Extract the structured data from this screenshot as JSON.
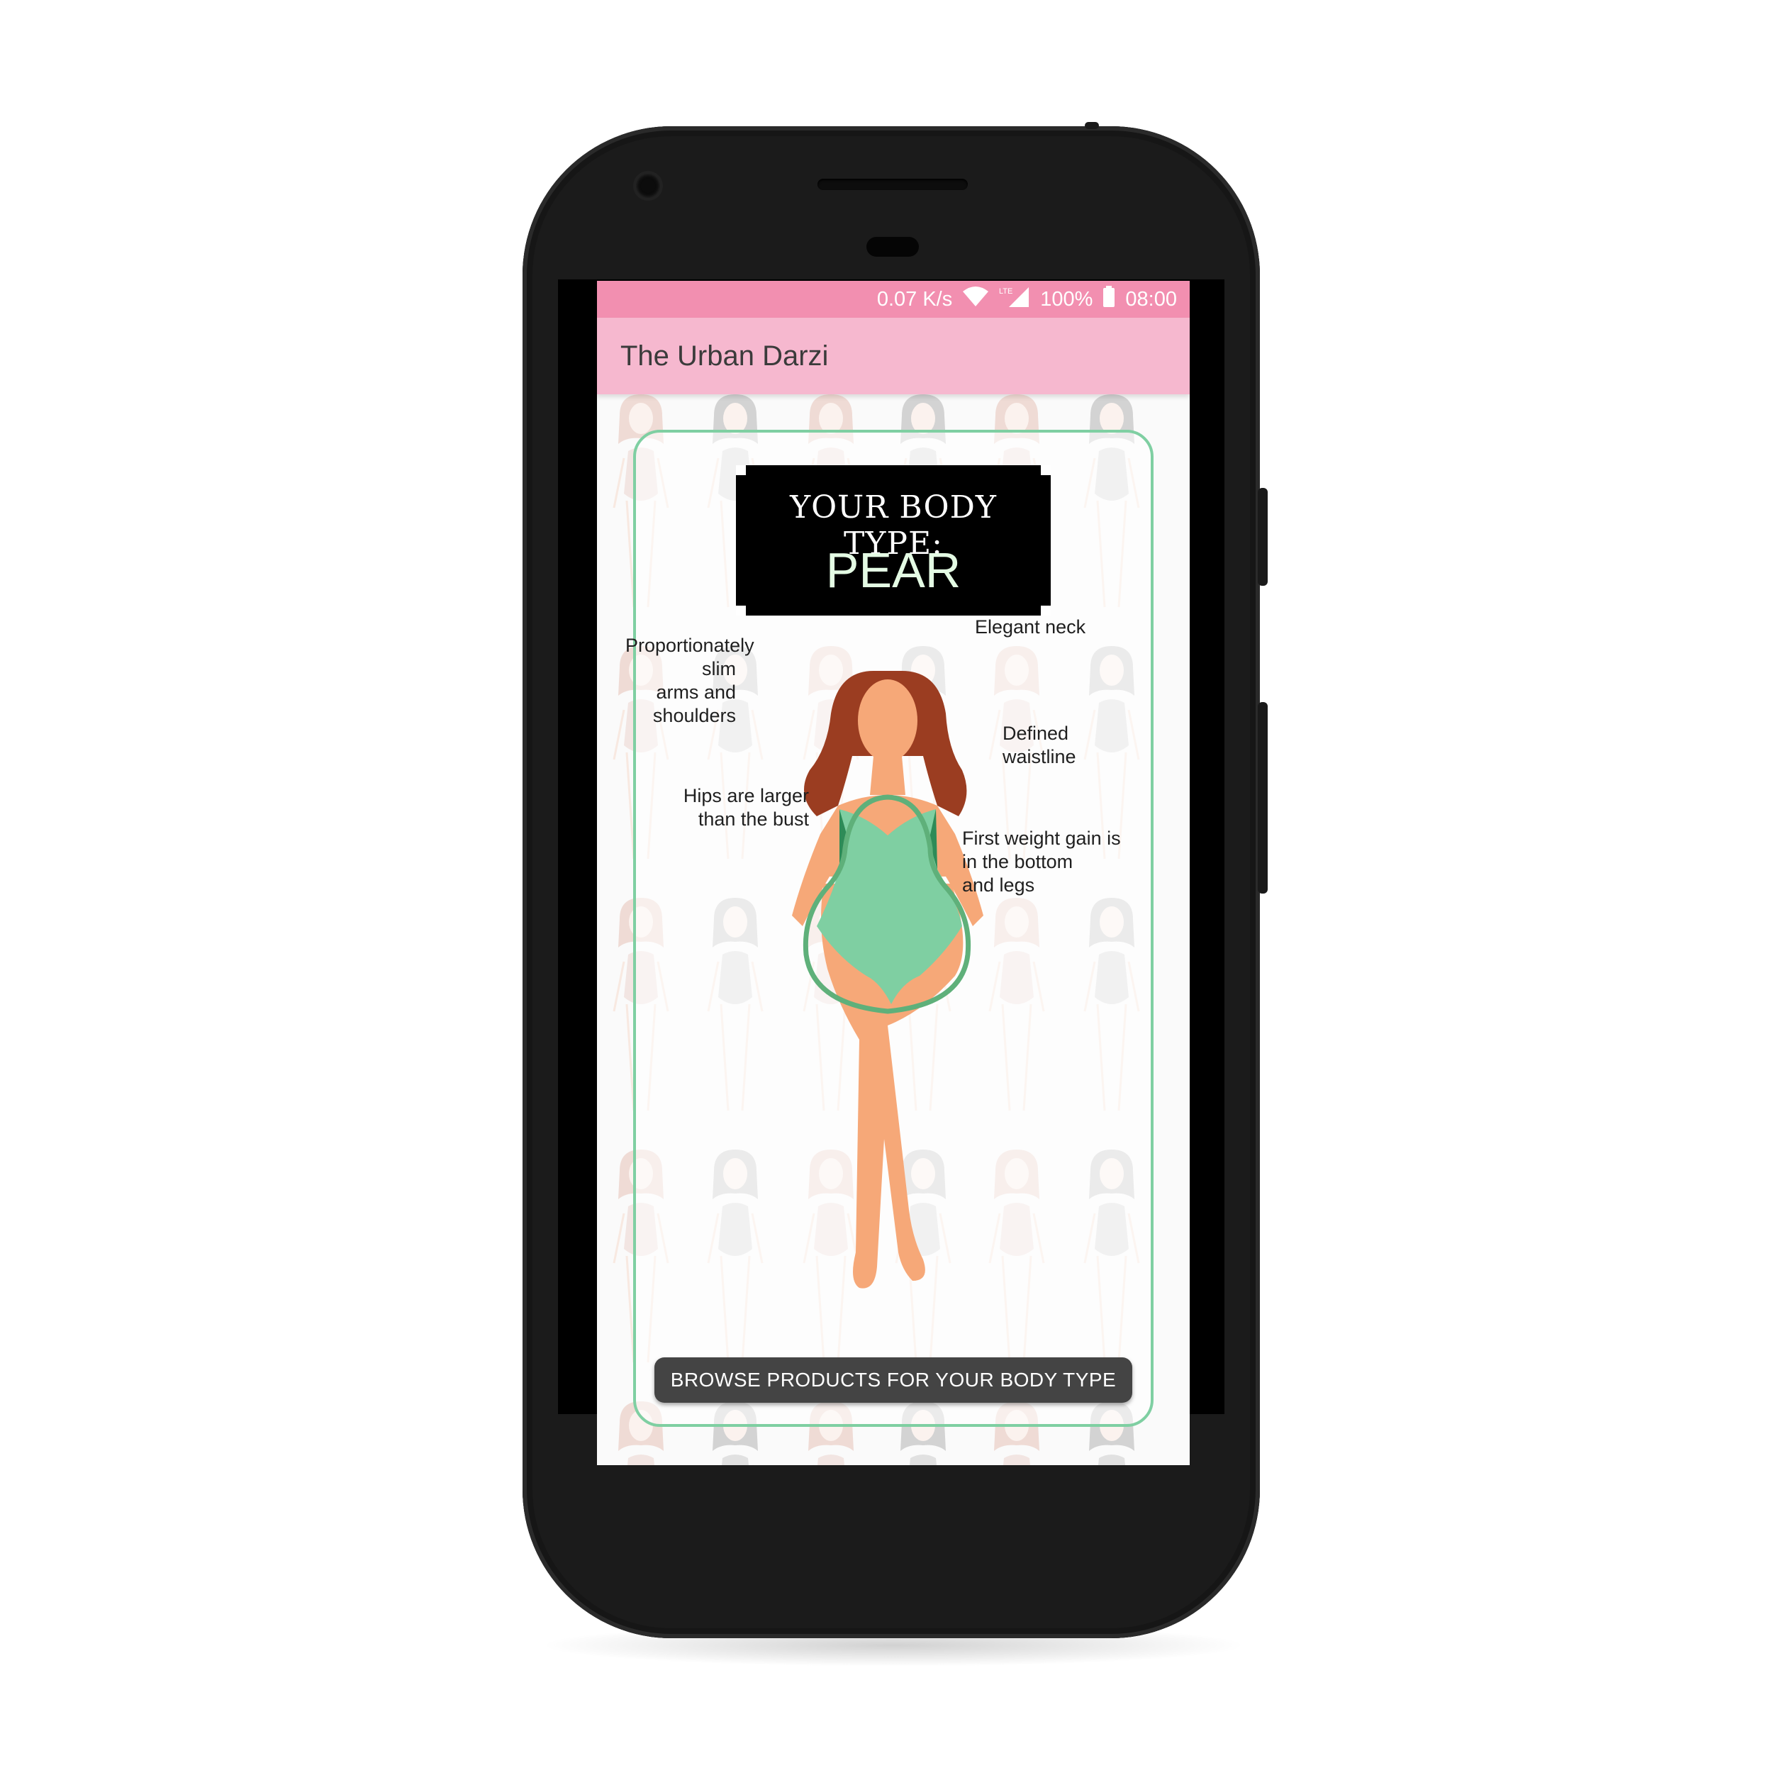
{
  "status_bar": {
    "net_speed": "0.07 K/s",
    "network_label": "LTE",
    "battery": "100%",
    "time": "08:00",
    "icons": [
      "wifi-icon",
      "signal-icon",
      "battery-icon"
    ]
  },
  "app_bar": {
    "title": "The Urban Darzi"
  },
  "result": {
    "heading": "YOUR BODY TYPE:",
    "body_type": "PEAR"
  },
  "annotations": {
    "arms": [
      "Proportionately slim",
      "arms and shoulders"
    ],
    "neck": [
      "Elegant neck"
    ],
    "waist": [
      "Defined",
      "waistline"
    ],
    "hips": [
      "Hips are larger",
      "than the bust"
    ],
    "weight": [
      "First weight gain is",
      "in the bottom",
      "and legs"
    ]
  },
  "cta": {
    "label": "BROWSE PRODUCTS FOR YOUR BODY TYPE"
  },
  "colors": {
    "status_bar": "#f28fb0",
    "app_bar": "#f6b8cf",
    "card_border": "#7fcfa2",
    "button": "#444444",
    "garment": "#7fcfa2",
    "skin": "#f6a878",
    "hair": "#9b3d21"
  }
}
